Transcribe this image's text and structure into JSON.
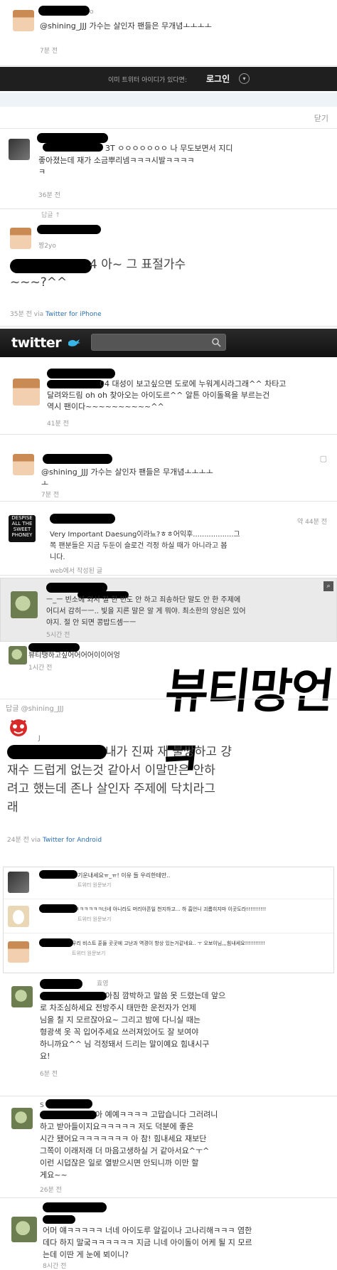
{
  "s1": {
    "text": "@shining_JJJ 가수는 살인자 팬들은 무개념ㅗㅗㅗㅗ",
    "time": "7분 전",
    "partial_handle": "o"
  },
  "login_bar": {
    "prompt": "이미 트위터 아이디가 있다면:",
    "button": "로그인"
  },
  "close_link": "닫기",
  "s2": {
    "text_line1": "3T ㅇㅇㅇㅇㅇㅇㅇ 나 무도보면서 지디",
    "text_line2": "좋아졌는데 재가 소금뿌리넴ㅋㅋㅋ시발ㅋㅋㅋㅋ",
    "text_line3": "ㅋ",
    "time": "36분 전"
  },
  "reply_label": "답글 ↑",
  "s3": {
    "handle": "짱2yo",
    "text_line1": "4 아~ 그 표절가수",
    "text_line2": "~~~?^^",
    "time": "35분 전",
    "via": "via",
    "client": "Twitter for iPhone"
  },
  "twitter_header": {
    "logo": "twitter"
  },
  "s4": {
    "text_line1": "04 대성이 보고싶으면 도로에 누워계시라그래^^ 차타고",
    "text_line2": "달려와드림 oh oh 찾아오는 아이도르^^ 알튼 아이돌욕을 부르는건",
    "text_line3": "역시 팬이다~~~~~~~~~~^^",
    "time": "41분 전"
  },
  "s5": {
    "text": "@shining_JJJ 가수는 살인자 팬들은 무개념ㅗㅗㅗㅗ",
    "text_line2": "ㅗ",
    "time": "7분 전"
  },
  "s6": {
    "time": "약 44분 전",
    "text_line1": "Very Important Daesung이라뇨?ㅎㅎ어익후..................그",
    "text_line2": "쪽 팬분들은 지금 두둔이 슬로건 걱정 하실 때가 아니라고 봅",
    "text_line3": "니다.",
    "source": "web에서 작성된 글",
    "avatar_text": "DESPISE ALL THE SWEET PHONEY"
  },
  "s7": {
    "text_line1": "ㅡ_ㅡ 빈소에 와서 절 한 번도 안 하고 죄송하단 말도 안 한 주제에",
    "text_line2": "어디서 감히ㅡㅡ.. 빛을 지른 말은 알 게 뭐야. 최소한의 양심은 있어",
    "text_line3": "야지. 절 안 되면 콩밥드셈ㅡㅡ",
    "time": "5시간 전"
  },
  "s8": {
    "text": "뷰티땡하고싶어어어어이이어엉",
    "time": "1시간 전",
    "handwriting": "뷰티망언ㅋ"
  },
  "s9": {
    "reply_label": "답글 @shining_JJJ",
    "marker": "J",
    "text_line1": "내가 진짜 재 불쌍하고 걍",
    "text_line2": "재수 드럽게 없는것 같아서 이말만은 안하",
    "text_line3": "려고 했는데 존나 살인자 주제에 닥치라그",
    "text_line4": "래",
    "time": "24분 전",
    "via": "via",
    "client": "Twitter for Android"
  },
  "s10": {
    "text": "기운내세요ㅠ_ㅠ! 이유 들 우리한테만..",
    "reply": "트위터 원문보기"
  },
  "s11": {
    "text": "ㅋㅋㅋㅋㅋㅋ너네 아니라도 머리아픈일 천지하고... 하 흡언니 괴롭히지마 이곳도라!!!!!!!!!!",
    "reply": "트위터 원문보기"
  },
  "s12": {
    "text": "우리 비스트 훈들 곳곳에 고난과 역경이 항상 있는거같네요.. ㅜ 오보이님,,,힘내세요!!!!!!!!!!",
    "reply": "트위터 원문보기"
  },
  "s13": {
    "handle": "효영",
    "text_line1": "아침 깜박하고 말씀 못 드렸는데 앞으",
    "text_line2": "로 차조심하세요 전방주시 태만한 운전자가 언제",
    "text_line3": "님을 칠 지 모르잖아요~ 그리고 밤에 다니실 때는",
    "text_line4": "형광색 옷 꼭 입어주세요 쓰러져있어도 잘 보여야",
    "text_line5": "하니까요^^ 님 걱정돼서 드리는 말이예요 힘내시구",
    "text_line6": "요!",
    "time": "6분 전"
  },
  "s14": {
    "handle_initial": "S",
    "text_line1": "아 예예ㅋㅋㅋㅋ 고맙습니다 그러려니",
    "text_line2": "하고 받아들이지요ㅋㅋㅋㅋㅋ 저도 덕분에 좋은",
    "text_line3": "시간 됐어요ㅋㅋㅋㅋㅋㅋㅋ 아 참! 힘내세요 재보단",
    "text_line4": "그쪽이 이래저래 더 마음고생하실 거 같아서요^ㅜ^",
    "text_line5": "이런 시덥잖은 일로 열받으시면 안되니까 이만 할",
    "text_line6": "게요~~",
    "time": "26분 전"
  },
  "s15": {
    "text_line1": "어머 얘ㅋㅋㅋㅋㅋ 너네 아이도루 알길이나 고나리해ㅋㅋㅋ 염한",
    "text_line2": "데다 하지 말궄ㅋㅋㅋㅋㅋㅋ 지금 니네 아이돌이 어케 될 지 모르",
    "text_line3": "는데 이딴 게 눈에 뵈이니?",
    "time": "8시간 전"
  }
}
